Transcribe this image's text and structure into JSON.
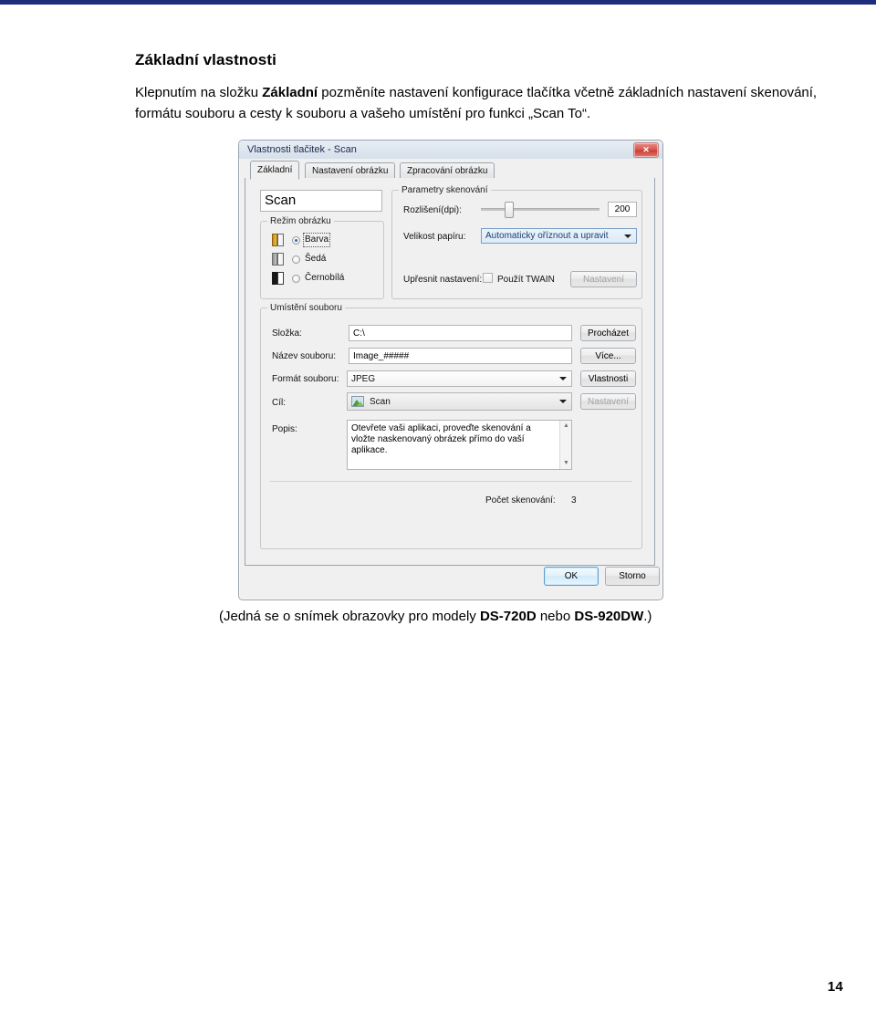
{
  "document": {
    "heading": "Základní vlastnosti",
    "paragraph_part1": "Klepnutím na složku ",
    "paragraph_bold": "Základní",
    "paragraph_part2": " pozměníte nastavení konfigurace tlačítka včetně základních nastavení skenování, formátu souboru a cesty k souboru a vašeho umístění pro funkci „Scan To“.",
    "caption_part1": "(Jedná se o snímek obrazovky pro modely ",
    "caption_bold1": "DS-720D",
    "caption_part2": " nebo ",
    "caption_bold2": "DS-920DW",
    "caption_part3": ".)",
    "page_number": "14",
    "accent_color": "#1f2b7b"
  },
  "dialog": {
    "title": "Vlastnosti tlačitek - Scan",
    "close_label": "✕",
    "tabs": [
      {
        "label": "Základní",
        "active": true
      },
      {
        "label": "Nastavení obrázku",
        "active": false
      },
      {
        "label": "Zpracování obrázku",
        "active": false
      }
    ],
    "button_name_value": "Scan",
    "image_mode": {
      "group_label": "Režim obrázku",
      "options": [
        {
          "label": "Barva",
          "selected": true
        },
        {
          "label": "Šedá",
          "selected": false
        },
        {
          "label": "Černobílá",
          "selected": false
        }
      ]
    },
    "scan_params": {
      "group_label": "Parametry skenování",
      "resolution_label": "Rozlišení(dpi):",
      "resolution_value": "200",
      "paper_size_label": "Velikost papíru:",
      "paper_size_value": "Automaticky oříznout a upravit",
      "advanced_label": "Upřesnit nastavení:",
      "twain_checkbox_label": "Použít TWAIN",
      "twain_checked": false,
      "settings_button": "Nastavení"
    },
    "file_location": {
      "group_label": "Umístění souboru",
      "folder_label": "Složka:",
      "folder_value": "C:\\",
      "browse_button": "Procházet",
      "filename_label": "Název souboru:",
      "filename_value": "Image_#####",
      "more_button": "Více...",
      "format_label": "Formát souboru:",
      "format_value": "JPEG",
      "properties_button": "Vlastnosti",
      "target_label": "Cíl:",
      "target_value": "Scan",
      "target_settings_button": "Nastavení",
      "description_label": "Popis:",
      "description_value": "Otevřete vaši aplikaci, proveďte skenování a vložte naskenovaný obrázek přímo do vaší aplikace.",
      "scan_count_label": "Počet skenování:",
      "scan_count_value": "3"
    },
    "footer": {
      "ok_button": "OK",
      "cancel_button": "Storno"
    }
  }
}
